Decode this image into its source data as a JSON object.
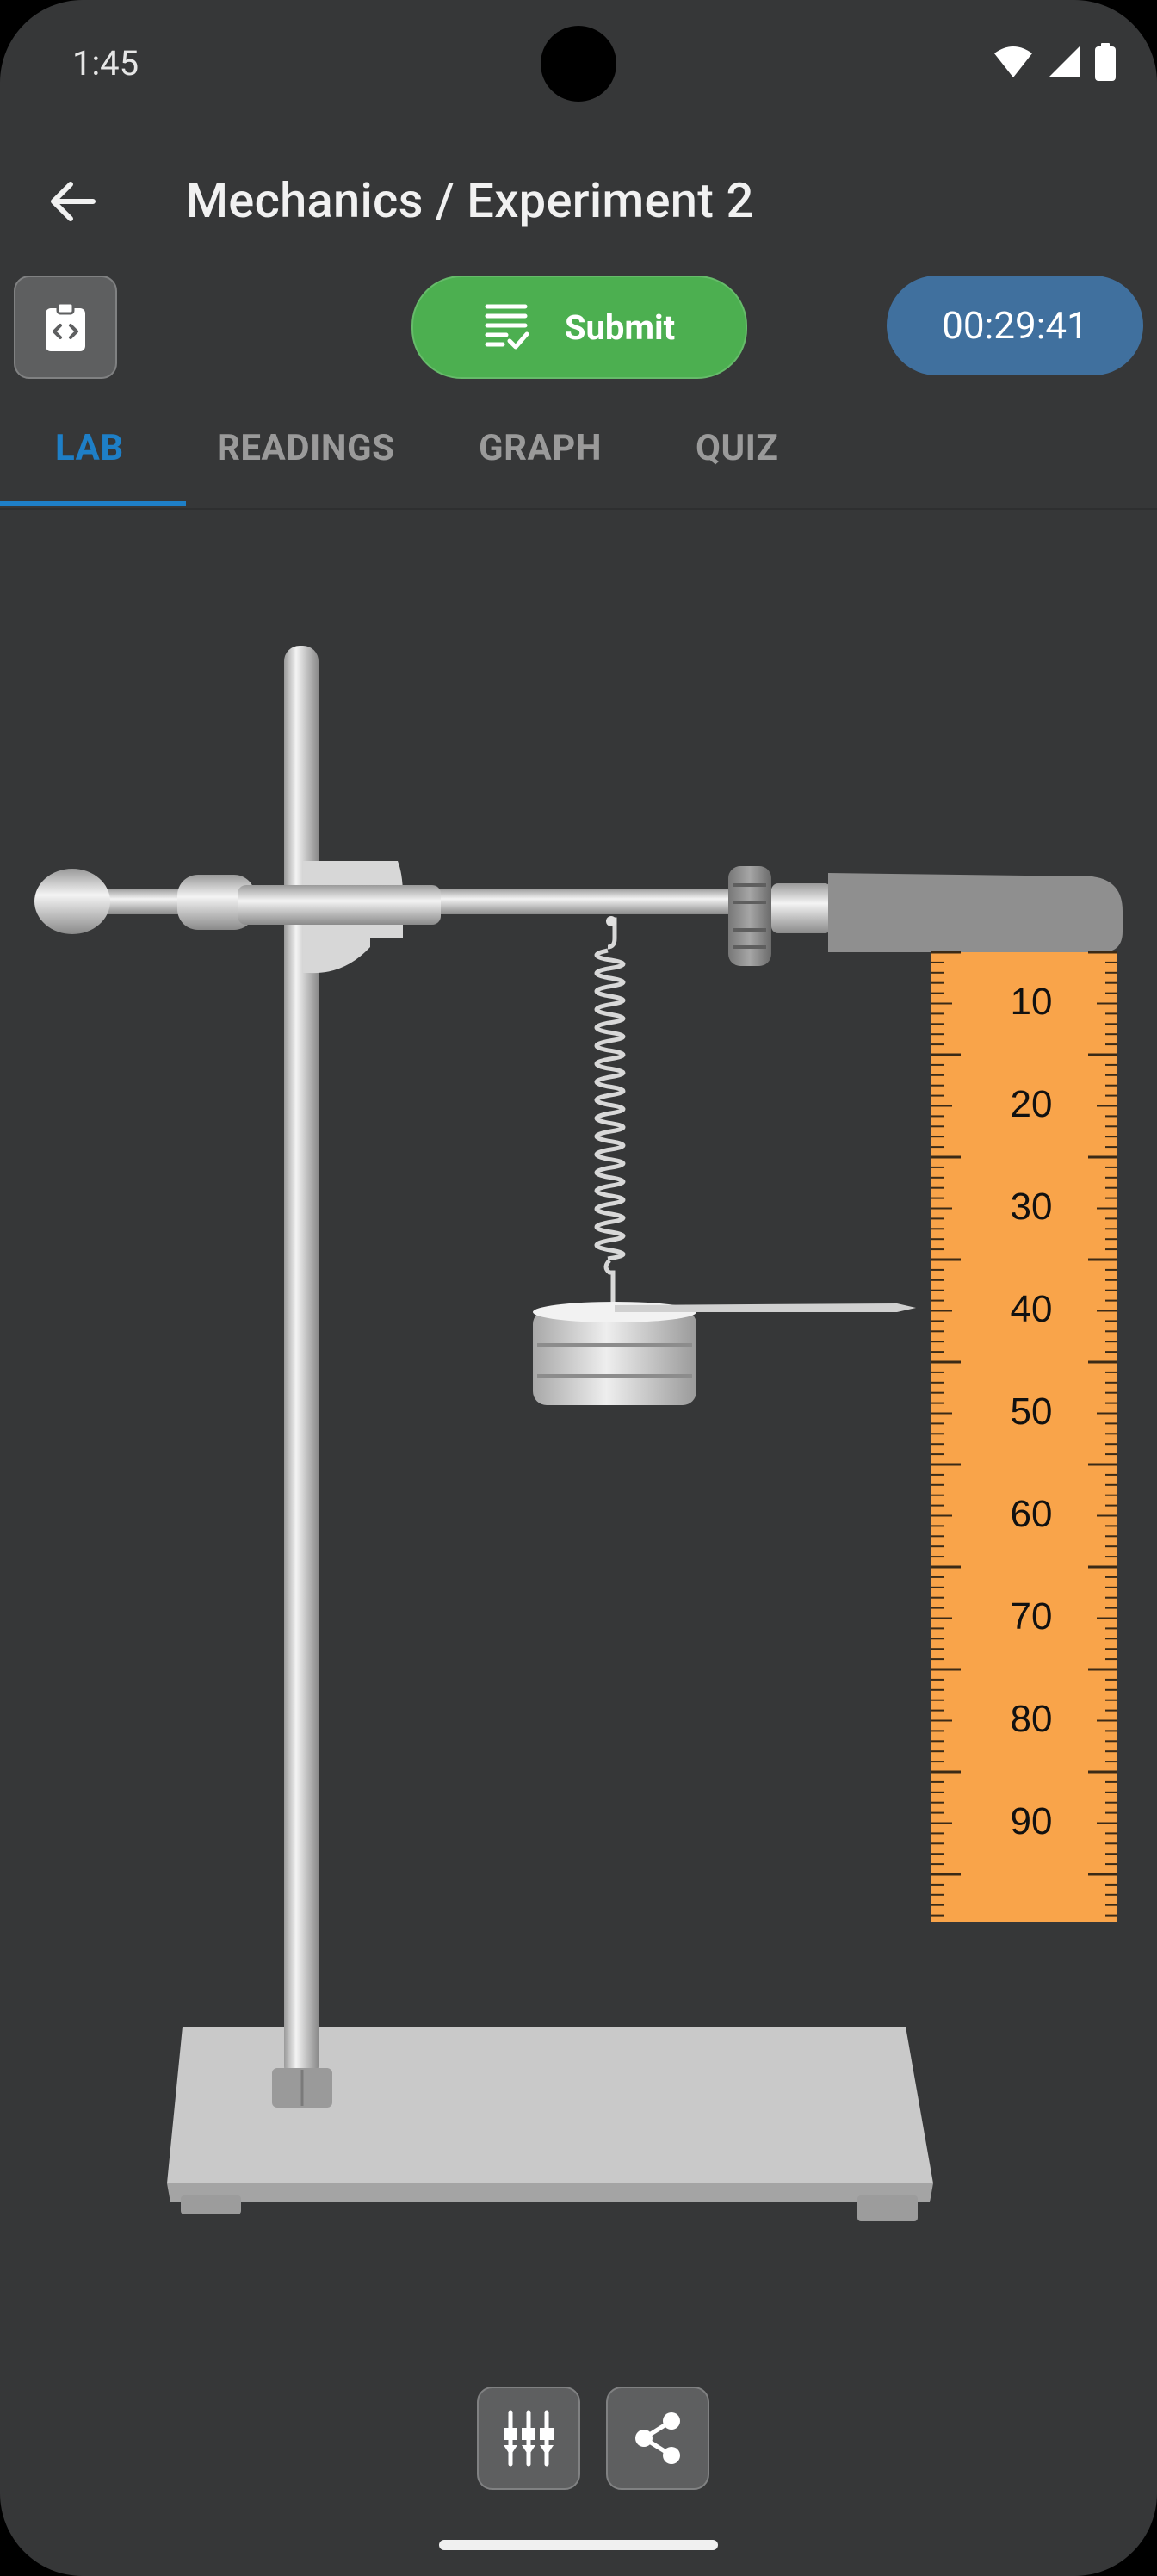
{
  "status_bar": {
    "time": "1:45",
    "icons": [
      "wifi-icon",
      "signal-icon",
      "battery-icon"
    ]
  },
  "header": {
    "title": "Mechanics / Experiment 2",
    "back_icon": "arrow-back-icon"
  },
  "toolbar": {
    "clipboard_icon": "clipboard-code-icon",
    "submit_label": "Submit",
    "submit_icon": "checklist-icon",
    "timer": "00:29:41"
  },
  "tabs": [
    {
      "label": "LAB",
      "active": true
    },
    {
      "label": "READINGS",
      "active": false
    },
    {
      "label": "GRAPH",
      "active": false
    },
    {
      "label": "QUIZ",
      "active": false
    }
  ],
  "lab": {
    "ruler_labels": [
      "10",
      "20",
      "30",
      "40",
      "50",
      "60",
      "70",
      "80",
      "90"
    ],
    "pointer_reading": "40"
  },
  "bottom": {
    "left_icon": "tuning-sliders-icon",
    "right_icon": "share-icon"
  },
  "colors": {
    "background": "#363738",
    "accent": "#1e7fc7",
    "submit": "#4caf50",
    "timer": "#40709e",
    "ruler": "#f9a44a"
  }
}
